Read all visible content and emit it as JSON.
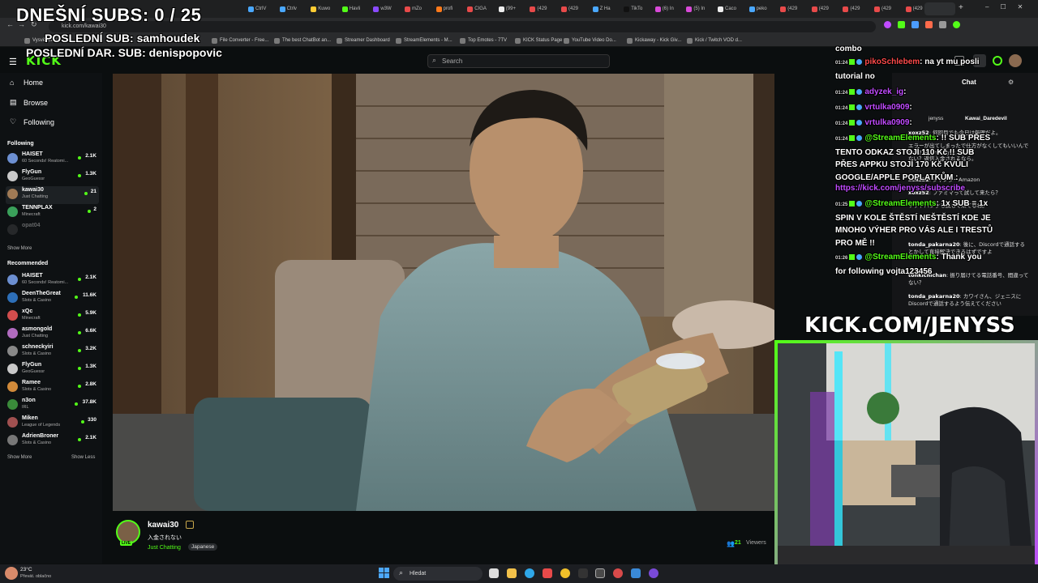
{
  "browser": {
    "url": "kick.com/kawai30",
    "tabs": [
      "CtrlV",
      "Ctrlv",
      "Kuwo",
      "Havli",
      "w3W",
      "mZo",
      "profi",
      "CIGA",
      "(99+",
      "(429",
      "(429",
      "Z Ha",
      "TikTo",
      "(6) In",
      "(5) In",
      "Caco",
      "peko",
      "(429",
      "(429",
      "(429",
      "(429",
      "(429"
    ],
    "bookmarks": [
      "Vysvědčení",
      "File Converter - Free...",
      "The best ChatBot an...",
      "Streamer Dashboard",
      "StreamElements - M...",
      "Top Emotes - 7TV",
      "KICK Status Page",
      "YouTube Video Do...",
      "Kickaway - Kick Giv...",
      "Kick / Twitch VOD d..."
    ]
  },
  "kick": {
    "logo": "KICK",
    "search_placeholder": "Search",
    "nav": [
      {
        "label": "Home",
        "icon": "home-icon"
      },
      {
        "label": "Browse",
        "icon": "browse-icon"
      },
      {
        "label": "Following",
        "icon": "heart-icon"
      }
    ],
    "following_header": "Following",
    "following": [
      {
        "name": "HAISET",
        "category": "60 Seconds! Reatomi...",
        "viewers": "2.1K",
        "color": "#6c8fd1"
      },
      {
        "name": "FlyGun",
        "category": "GeoGuessr",
        "viewers": "1.3K",
        "color": "#c9c9c9"
      },
      {
        "name": "kawai30",
        "category": "Just Chatting",
        "viewers": "21",
        "color": "#a07a55"
      },
      {
        "name": "TENNPLAX",
        "category": "Minecraft",
        "viewers": "2",
        "color": "#3aa05a"
      },
      {
        "name": "opat04",
        "category": "",
        "viewers": "",
        "color": "#555555"
      }
    ],
    "show_more_1": "Show More",
    "recommended_header": "Recommended",
    "recommended": [
      {
        "name": "HAISET",
        "category": "60 Seconds! Reatomi...",
        "viewers": "2.1K",
        "color": "#6c8fd1"
      },
      {
        "name": "DeenTheGreat",
        "category": "Slots & Casino",
        "viewers": "11.6K",
        "color": "#2d6fb8"
      },
      {
        "name": "xQc",
        "category": "Minecraft",
        "viewers": "5.9K",
        "color": "#d14d4d"
      },
      {
        "name": "asmongold",
        "category": "Just Chatting",
        "viewers": "6.6K",
        "color": "#b06bbf"
      },
      {
        "name": "schneckyiri",
        "category": "Slots & Casino",
        "viewers": "3.2K",
        "color": "#888888"
      },
      {
        "name": "FlyGun",
        "category": "GeoGuessr",
        "viewers": "1.3K",
        "color": "#c9c9c9"
      },
      {
        "name": "Ramee",
        "category": "Slots & Casino",
        "viewers": "2.8K",
        "color": "#d18a3a"
      },
      {
        "name": "n3on",
        "category": "IRL",
        "viewers": "37.8K",
        "color": "#3a8a3a"
      },
      {
        "name": "Miken",
        "category": "League of Legends",
        "viewers": "330",
        "color": "#a05050"
      },
      {
        "name": "AdrienBroner",
        "category": "Slots & Casino",
        "viewers": "2.1K",
        "color": "#777777"
      }
    ],
    "show_more_2": "Show More",
    "show_less": "Show Less",
    "stream": {
      "streamer": "kawai30",
      "title": "入金されない",
      "category": "Just Chatting",
      "tag": "Japanese",
      "live_badge": "LIVE",
      "viewers": "21",
      "viewers_label": "Viewers"
    },
    "chat": {
      "title": "Chat",
      "pinned_user": "Kawai_Daredevil",
      "top_user": "jenyss",
      "messages": [
        {
          "user": "xoxz52",
          "text": ": 何回目でも今日は無理だよ。"
        },
        {
          "user": "",
          "text": "エラーが出てしまったで仕方がなくしてもいいんですか？そうするかなぁ。"
        },
        {
          "user": "",
          "text": "ない？返信入金されるなら。"
        },
        {
          "user": "xoxz52",
          "text": ": ジャンダーAmazon"
        },
        {
          "user": "xoxz52",
          "text": ": ファミマって試して来たら？"
        },
        {
          "user": "",
          "text": "ソフトバンクも試して来てるね。"
        },
        {
          "user": "tonda_pakarna20",
          "text": ": 後に、Discordで通話するとかして直接解決できるはずですよ"
        },
        {
          "user": "tonkichichan",
          "text": ": 振り届けてる電話番号、間違ってない？"
        },
        {
          "user": "tonda_pakarna20",
          "text": ": カワイさん、ジェニスにDiscordで通話するよう伝えてください"
        }
      ]
    }
  },
  "overlay": {
    "subs_goal": "DNEŠNÍ SUBS: 0 / 25",
    "last_sub": "POSLEDNÍ SUB: samhoudek",
    "last_donation": "POSLEDNÍ DAR. SUB: denispopovic",
    "kick_url": "KICK.COM/JENYSS",
    "chat_top": "combo",
    "chat": [
      {
        "time": "01:24",
        "user": "pikoSchlebem",
        "user_color": "#ff4b4b",
        "text": ": na yt mu posli tutorial no"
      },
      {
        "time": "01:24",
        "user": "adyzek_ig",
        "user_color": "#c04bff",
        "text": ":"
      },
      {
        "time": "01:24",
        "user": "vrtulka0909",
        "user_color": "#c04bff",
        "text": ":"
      },
      {
        "time": "01:24",
        "user": "vrtulka0909",
        "user_color": "#c04bff",
        "text": ":"
      },
      {
        "time": "01:24",
        "user": "@StreamElements",
        "user_color": "#53fc18",
        "text": ": !! SUB PŘES TENTO ODKAZ STOJÍ 110 Kč !! SUB PŘES APPKU STOJÍ 170 Kč KVŮLI GOOGLE/APPLE POPLATKŮM :"
      },
      {
        "time": "",
        "user": "",
        "user_color": "#c04bff",
        "text": "https://kick.com/jenyss/subscribe"
      },
      {
        "time": "01:25",
        "user": "@StreamElements",
        "user_color": "#53fc18",
        "text": ": 1x SUB = 1x SPIN V KOLE ŠTĚSTÍ NEŠTĚSTÍ KDE JE MNOHO VÝHER PRO VÁS ALE I TRESTŮ PRO MĚ !!"
      },
      {
        "time": "01:26",
        "user": "@StreamElements",
        "user_color": "#53fc18",
        "text": ": Thank you for following vojta123456"
      }
    ]
  },
  "taskbar": {
    "weather_temp": "23°C",
    "weather_desc": "Převát. oblačno",
    "search_placeholder": "Hledat"
  }
}
